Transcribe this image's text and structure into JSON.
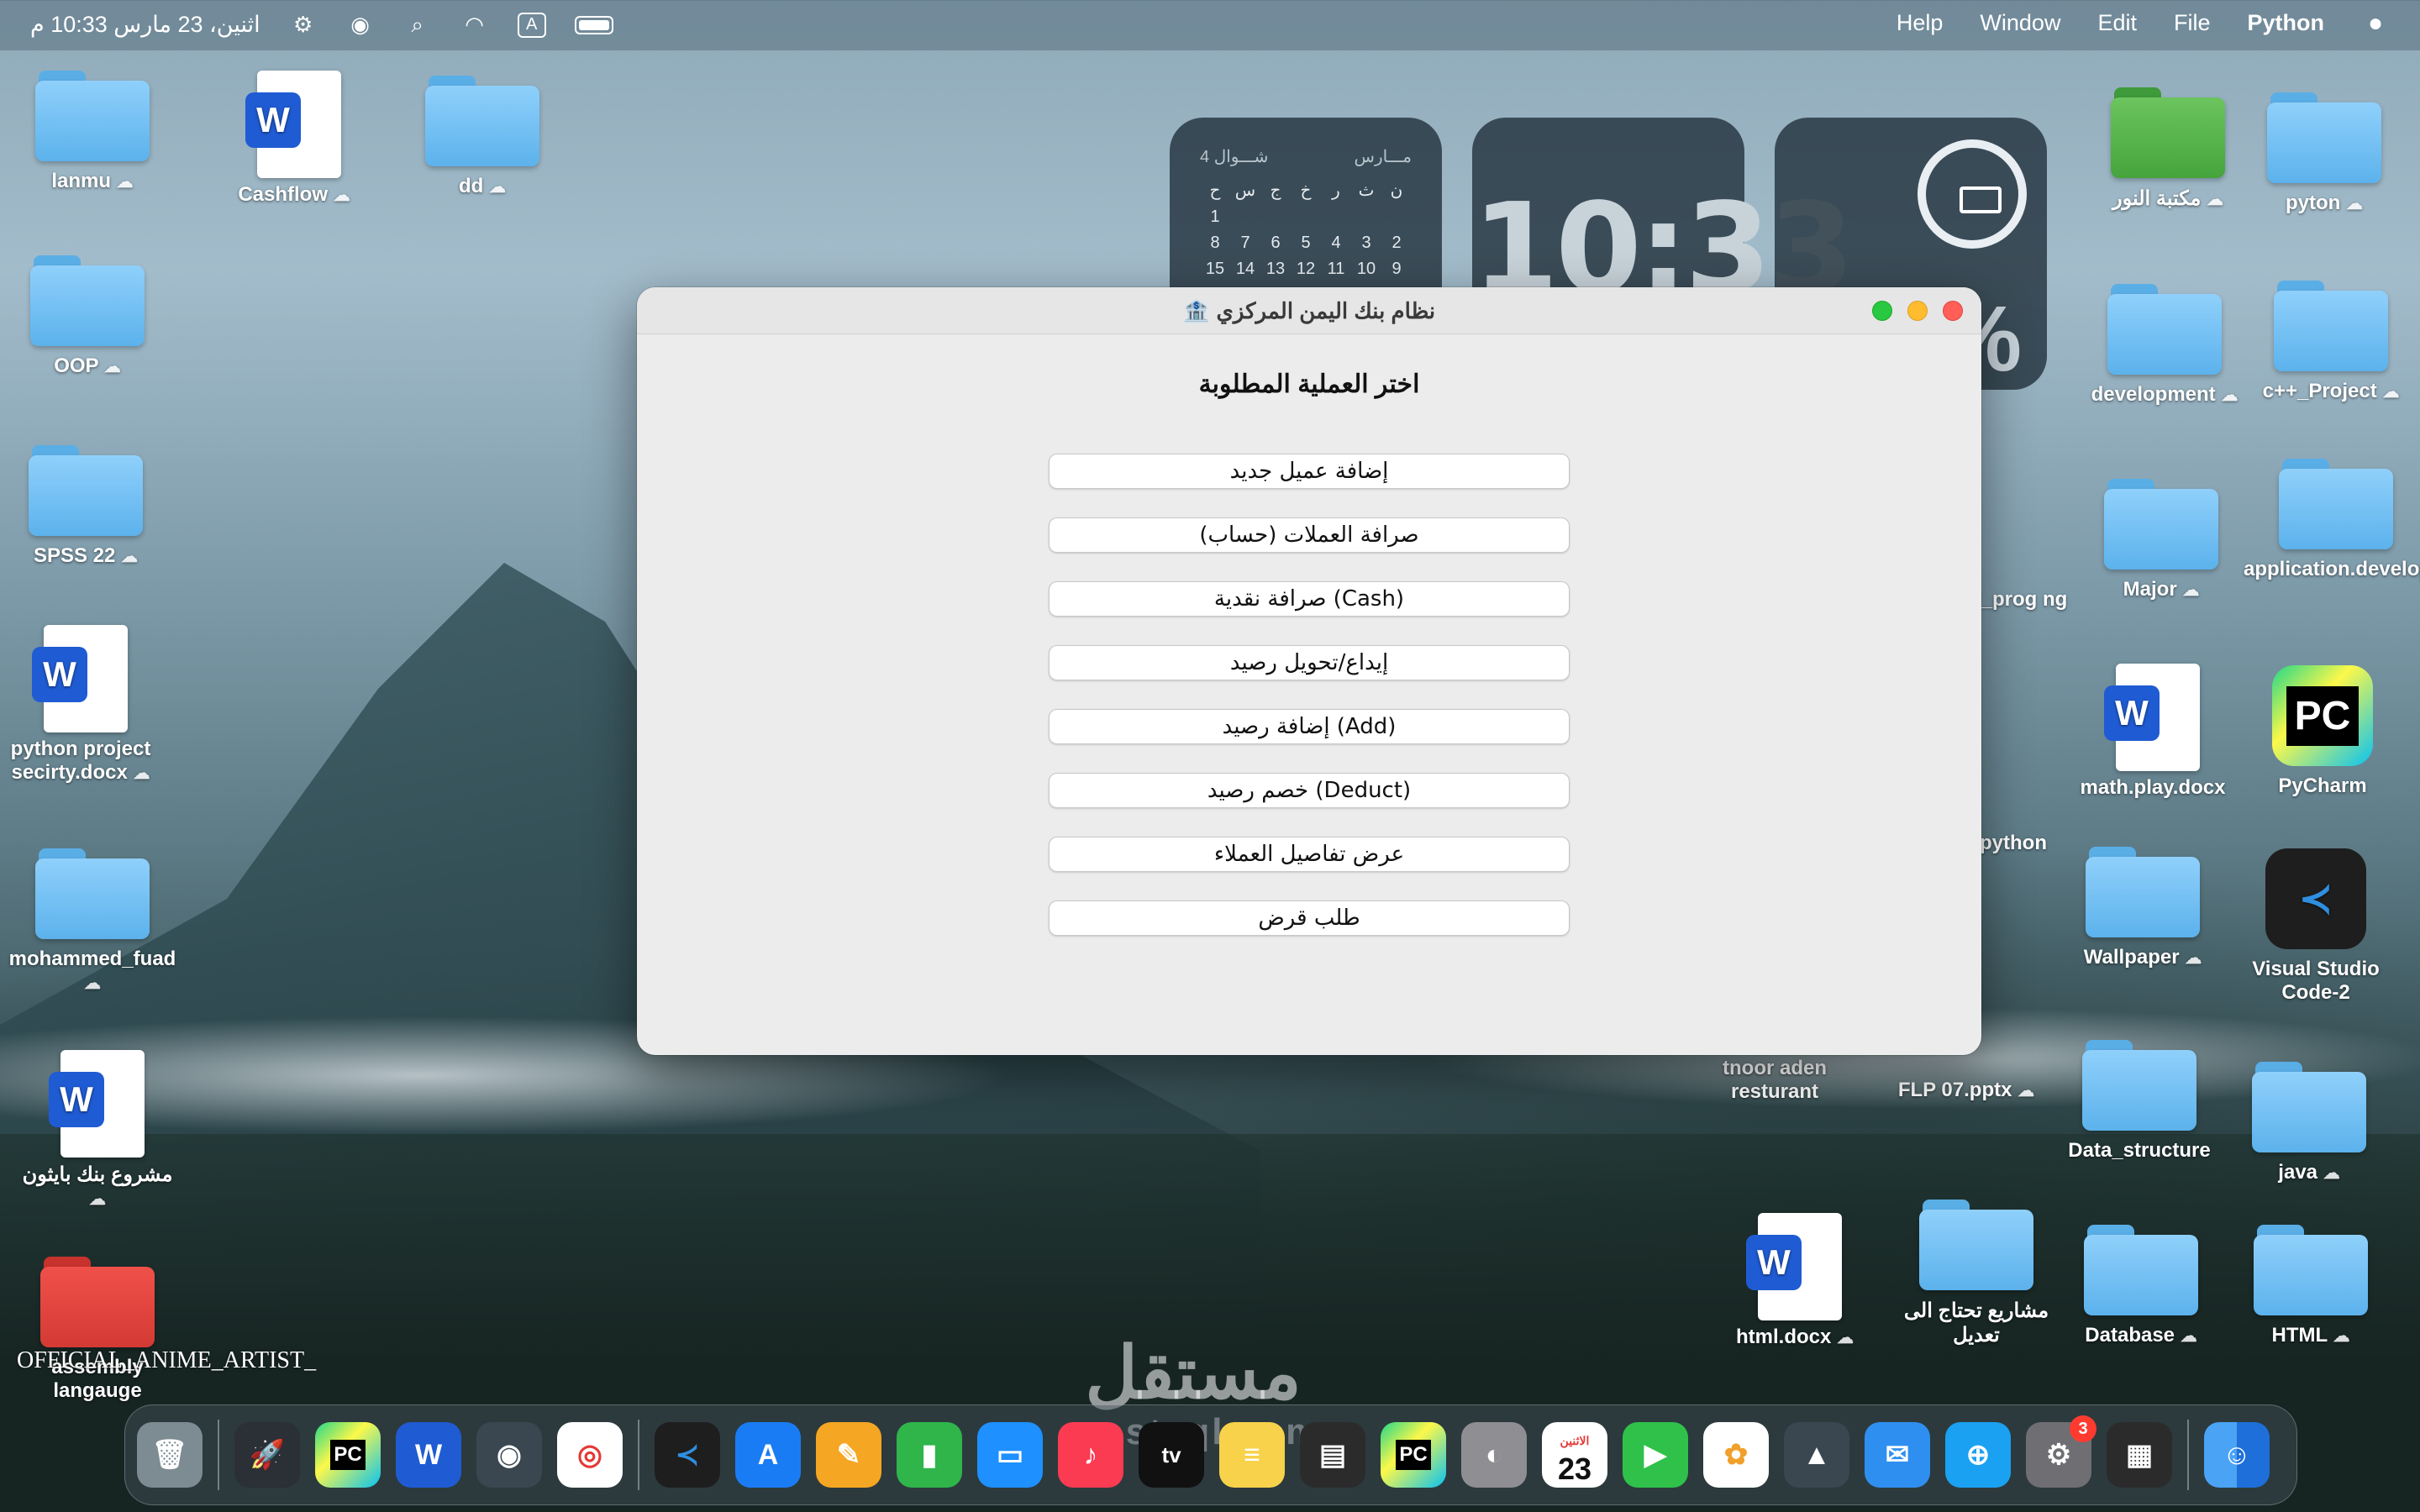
{
  "menubar": {
    "apple": "",
    "app": "Python",
    "menus": [
      "File",
      "Edit",
      "Window",
      "Help"
    ],
    "input_source": "A",
    "datetime": "اثنين، 23 مارس  10:33 م"
  },
  "widgets": {
    "calendar": {
      "month_left": "4 شـــوال",
      "month_right": "مـــارس",
      "days": [
        "ن",
        "ث",
        "ر",
        "خ",
        "ج",
        "س",
        "ح"
      ],
      "rows": [
        [
          "",
          "",
          "",
          "",
          "",
          "",
          "1"
        ],
        [
          "2",
          "3",
          "4",
          "5",
          "6",
          "7",
          "8"
        ],
        [
          "9",
          "10",
          "11",
          "12",
          "13",
          "14",
          "15"
        ]
      ]
    },
    "clock": "10:33",
    "battery_pct": "%"
  },
  "window": {
    "title": "🏦 نظام بنك اليمن المركزي",
    "heading": "اختر العملية المطلوبة",
    "buttons": [
      "إضافة عميل جديد",
      "صرافة العملات (حساب)",
      "صرافة نقدية (Cash)",
      "إيداع/تحويل رصيد",
      "إضافة رصيد (Add)",
      "خصم رصيد (Deduct)",
      "عرض تفاصيل العملاء",
      "طلب قرض"
    ]
  },
  "desktop": {
    "left": [
      "lanmu",
      "Cashflow",
      "dd",
      "OOP",
      "SPSS 22",
      "python project secirty.docx",
      "mohammed_fuad",
      "مشروع بنك بايثون",
      "assembly langauge"
    ],
    "right": [
      "pyton",
      "مكتبة النور",
      "c++_Project",
      "development",
      "application.development",
      "Major",
      "al_prog ng",
      "PyCharm",
      "math.play.docx",
      "python",
      "Visual Studio Code-2",
      "Wallpaper",
      "FLP 07.pptx",
      "tnoor aden resturant",
      "java",
      "Data_structure",
      "HTML",
      "Database",
      "مشاريع تحتاج الى تعديل",
      "html.docx"
    ]
  },
  "overlay": {
    "anime_label": "OFFICIAL_ANIME_ARTIST_"
  },
  "dock": {
    "settings_badge": "3",
    "calendar_day": "23",
    "calendar_weekday": "الاثنين",
    "tv_label": "tv"
  },
  "watermark": {
    "ar": "مستقل",
    "en": "mostaql.com"
  }
}
